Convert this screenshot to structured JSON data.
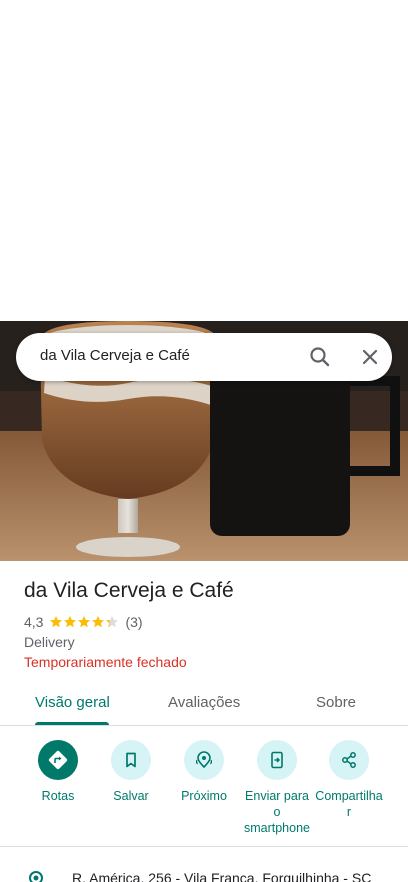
{
  "search": {
    "query": "da Vila Cerveja e Café",
    "search_icon": "search-icon",
    "close_icon": "close-icon"
  },
  "place": {
    "name": "da Vila Cerveja e Café",
    "rating": "4,3",
    "rating_value": 4.3,
    "review_count": "(3)",
    "category": "Delivery",
    "status": "Temporariamente fechado",
    "star_color": "#fbbc04",
    "status_color": "#d93025"
  },
  "tabs": [
    {
      "label": "Visão geral",
      "active": true
    },
    {
      "label": "Avaliações",
      "active": false
    },
    {
      "label": "Sobre",
      "active": false
    }
  ],
  "actions": [
    {
      "label": "Rotas",
      "icon": "directions-icon"
    },
    {
      "label": "Salvar",
      "icon": "bookmark-icon"
    },
    {
      "label": "Próximo",
      "icon": "nearby-icon"
    },
    {
      "label": "Enviar para o smartphone",
      "label_lines": [
        "Enviar para",
        "o",
        "smartphone"
      ],
      "icon": "send-to-phone-icon"
    },
    {
      "label": "Compartilhar",
      "label_lines": [
        "Compartilha",
        "r"
      ],
      "icon": "share-icon"
    }
  ],
  "address": {
    "text": "R. América, 256 - Vila Franca, Forquilhinha - SC",
    "icon": "location-pin-icon"
  },
  "accent_color": "#00796b"
}
